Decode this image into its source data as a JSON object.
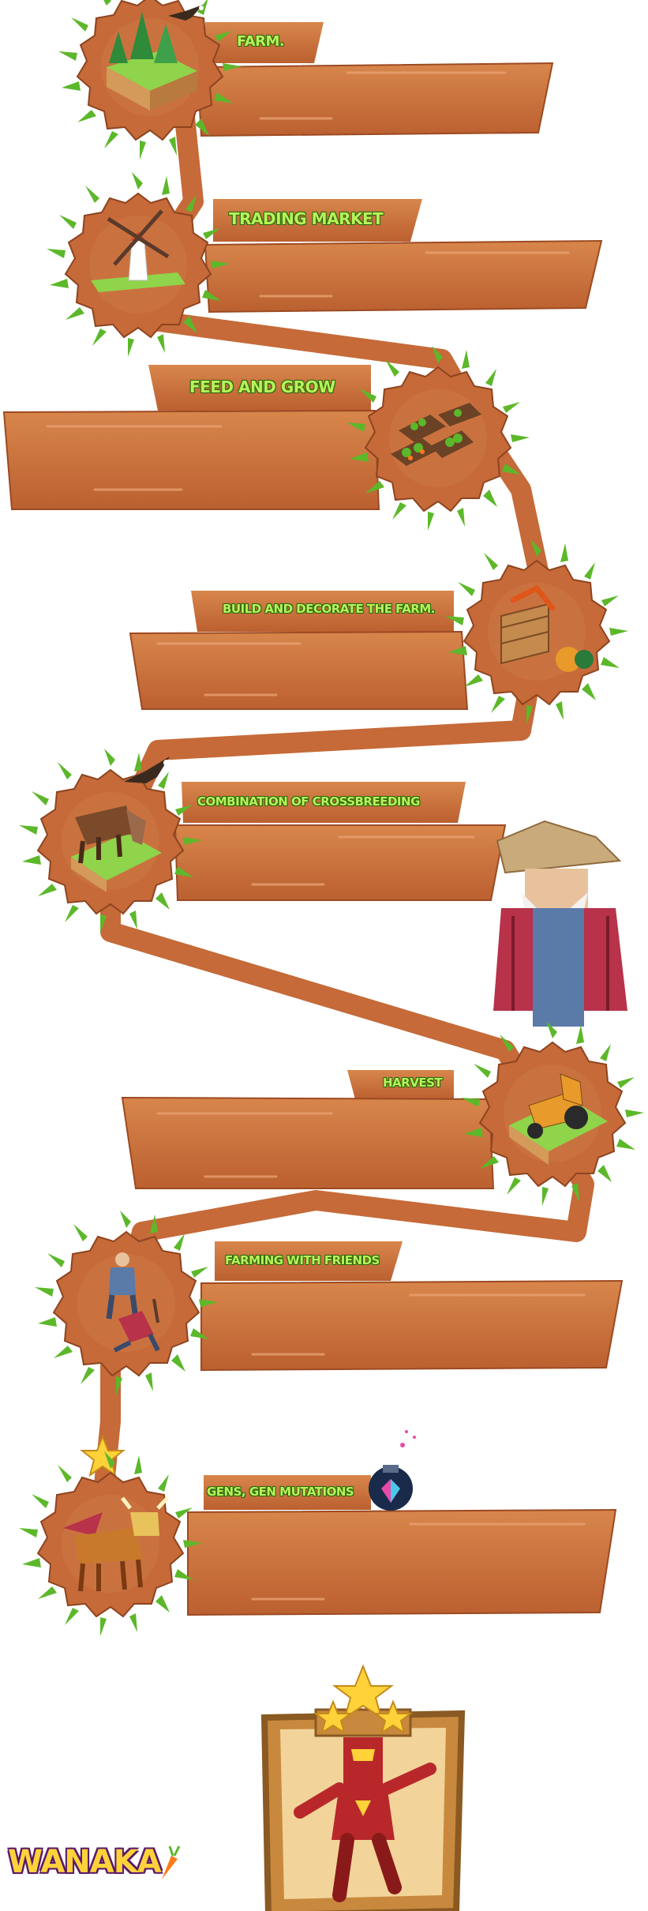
{
  "features": [
    {
      "title": "FARM.",
      "icon": "forest-island-icon"
    },
    {
      "title": "TRADING MARKET",
      "icon": "windmill-icon"
    },
    {
      "title": "FEED AND GROW",
      "icon": "crop-plots-icon"
    },
    {
      "title": "BUILD AND DECORATE THE FARM.",
      "icon": "produce-crate-icon"
    },
    {
      "title": "COMBINATION OF CROSSBREEDING",
      "icon": "cow-icon"
    },
    {
      "title": "HARVEST",
      "icon": "tractor-icon"
    },
    {
      "title": "FARMING WITH FRIENDS",
      "icon": "farmers-icon"
    },
    {
      "title": "GENS, GEN MUTATIONS",
      "icon": "winged-bull-icon"
    }
  ],
  "logo": {
    "text": "WANAKA"
  },
  "colors": {
    "plank": "#c56a38",
    "plank_dark": "#9c4a22",
    "leaf": "#5cb82a",
    "title_text": "#b8f25a"
  },
  "decorations": [
    "eagle-icon",
    "farmer-character-icon",
    "potion-flask-icon",
    "star-icon",
    "hero-card-icon"
  ]
}
